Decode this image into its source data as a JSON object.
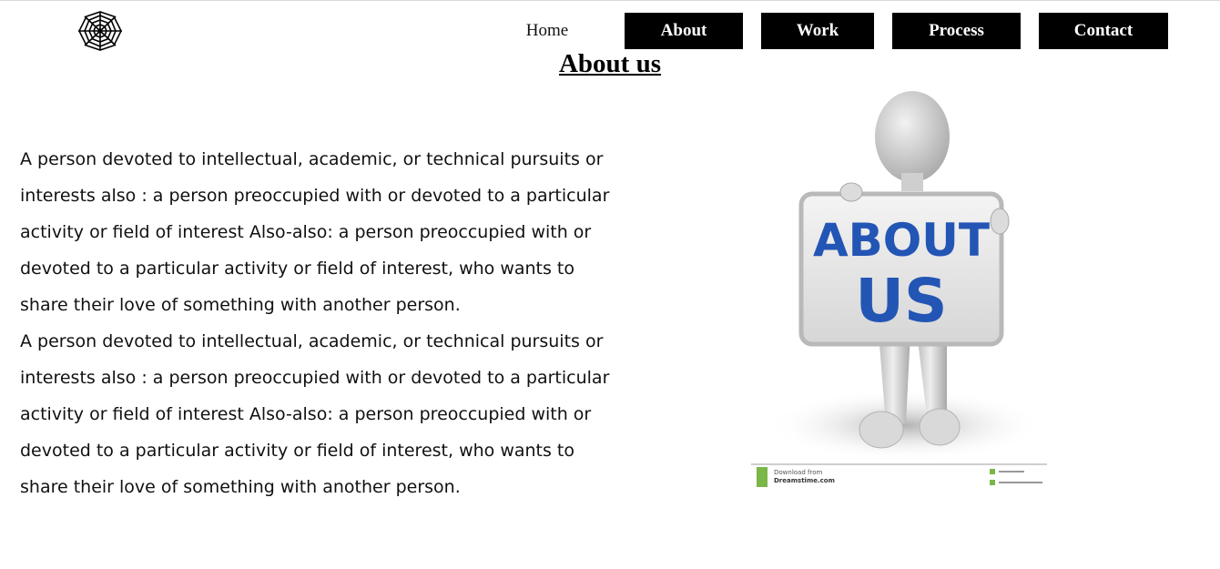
{
  "header": {
    "logo_icon": "spider-web-icon",
    "nav": {
      "home": "Home",
      "about": "About",
      "work": "Work",
      "process": "Process",
      "contact": "Contact"
    }
  },
  "main": {
    "title": "About us",
    "paragraphs": [
      "A person devoted to intellectual, academic, or technical pursuits or interests also : a person preoccupied with or devoted to a particular activity or field of interest Also-also: a person preoccupied with or devoted to a particular activity or field of interest, who wants to share their love of something with another person.",
      "A person devoted to intellectual, academic, or technical pursuits or interests also : a person preoccupied with or devoted to a particular activity or field of interest Also-also: a person preoccupied with or devoted to a particular activity or field of interest, who wants to share their love of something with another person."
    ],
    "image": {
      "sign_line1": "ABOUT",
      "sign_line2": "US",
      "footer_text": "Download from",
      "footer_site": "Dreamstime.com"
    }
  },
  "colors": {
    "nav_bg": "#000000",
    "nav_text": "#ffffff",
    "sign_text": "#2355b5",
    "footer_green": "#7ab648"
  }
}
